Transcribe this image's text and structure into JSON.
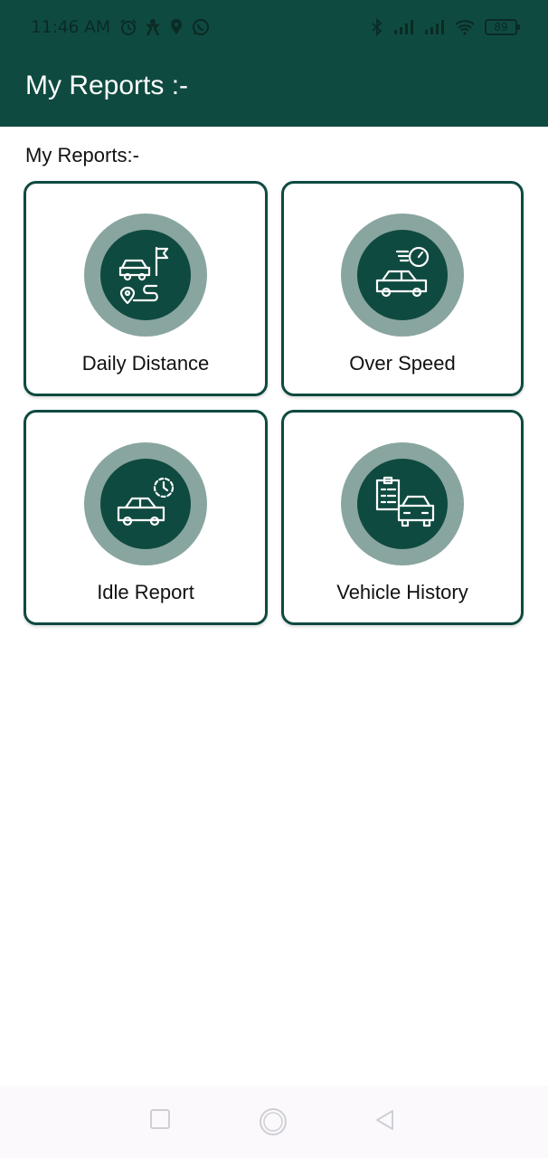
{
  "status_bar": {
    "time": "11:46 AM",
    "battery": "89",
    "left_icons": [
      "alarm-icon",
      "person-icon",
      "location-icon",
      "whatsapp-icon"
    ],
    "right_icons": [
      "bluetooth-icon",
      "signal-icon",
      "signal-icon",
      "wifi-icon",
      "battery-icon"
    ]
  },
  "app_bar": {
    "title": "My Reports :-"
  },
  "section": {
    "title": "My Reports:-"
  },
  "cards": [
    {
      "label": "Daily Distance",
      "icon": "car-route-icon"
    },
    {
      "label": "Over Speed",
      "icon": "car-speed-icon"
    },
    {
      "label": "Idle Report",
      "icon": "car-clock-icon"
    },
    {
      "label": "Vehicle History",
      "icon": "vehicle-history-icon"
    }
  ],
  "colors": {
    "primary": "#0f4a40",
    "icon_ring": "#89a5a0",
    "background": "#ffffff"
  },
  "nav": [
    "recent-apps-icon",
    "home-icon",
    "back-icon"
  ]
}
